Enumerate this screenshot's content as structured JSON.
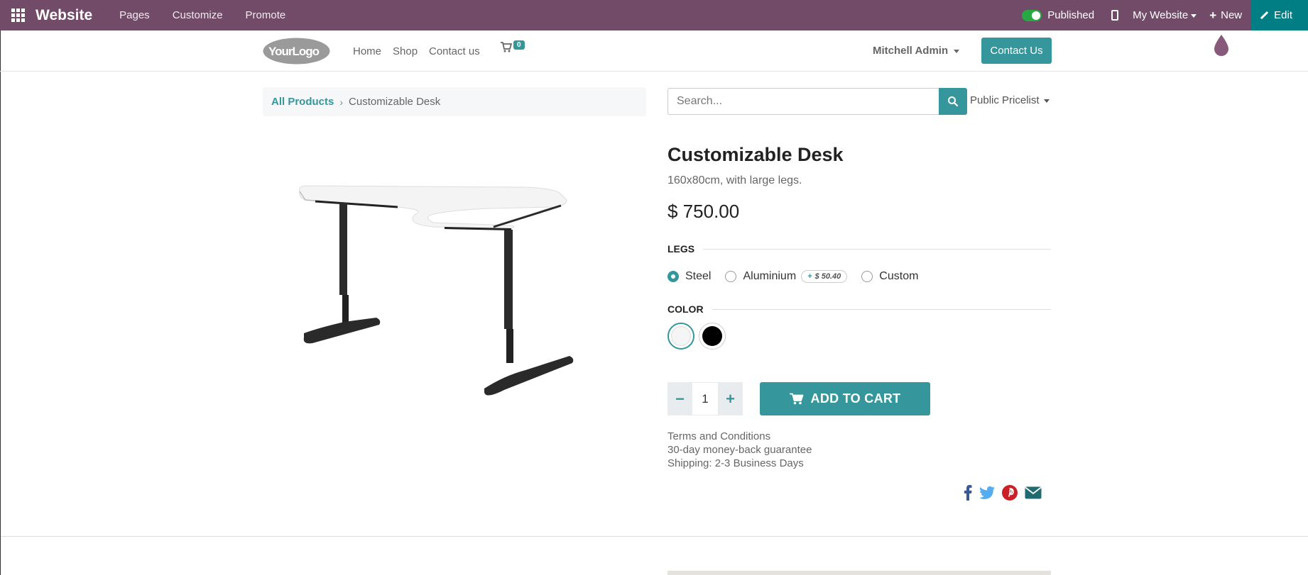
{
  "admin_bar": {
    "brand": "Website",
    "menus": [
      "Pages",
      "Customize",
      "Promote"
    ],
    "published_label": "Published",
    "my_website_label": "My Website",
    "new_label": "New",
    "edit_label": "Edit",
    "colors": {
      "bar": "#714b67",
      "edit": "#017e84"
    }
  },
  "header": {
    "logo_text": "YourLogo",
    "nav": [
      "Home",
      "Shop",
      "Contact us"
    ],
    "cart_count": "0",
    "user_name": "Mitchell Admin",
    "contact_button": "Contact Us"
  },
  "breadcrumb": {
    "parent": "All Products",
    "current": "Customizable Desk"
  },
  "search": {
    "placeholder": "Search...",
    "pricelist_label": "Public Pricelist"
  },
  "product": {
    "title": "Customizable Desk",
    "description": "160x80cm, with large legs.",
    "price": "$ 750.00",
    "legs_label": "LEGS",
    "legs_options": [
      {
        "label": "Steel",
        "selected": true
      },
      {
        "label": "Aluminium",
        "extra": "$ 50.40",
        "selected": false
      },
      {
        "label": "Custom",
        "selected": false
      }
    ],
    "extra_prefix": "+",
    "color_label": "COLOR",
    "colors": [
      {
        "name": "White",
        "hex": "#f5f5f5",
        "selected": true
      },
      {
        "name": "Black",
        "hex": "#000000",
        "selected": false
      }
    ],
    "quantity": "1",
    "add_to_cart_label": "ADD TO CART",
    "terms": [
      "Terms and Conditions",
      "30-day money-back guarantee",
      "Shipping: 2-3 Business Days"
    ]
  },
  "share_icons": [
    "facebook-icon",
    "twitter-icon",
    "pinterest-icon",
    "email-icon"
  ],
  "accent": "#35979c"
}
